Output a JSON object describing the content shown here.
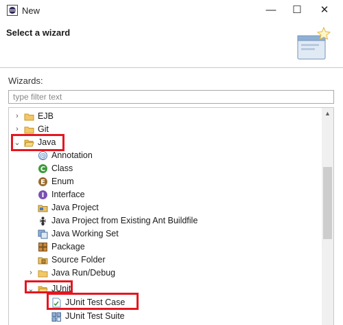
{
  "window": {
    "title": "New",
    "minimize_glyph": "—",
    "maximize_glyph": "☐",
    "close_glyph": "✕"
  },
  "banner": {
    "title": "Select a wizard",
    "icon": "wizard-banner-icon"
  },
  "wizards_label": "Wizards:",
  "filter": {
    "placeholder": "type filter text",
    "value": ""
  },
  "tree": {
    "items": [
      {
        "label": "EJB",
        "icon": "folder-icon",
        "state": "collapsed"
      },
      {
        "label": "Git",
        "icon": "folder-icon",
        "state": "collapsed"
      },
      {
        "label": "Java",
        "icon": "folder-open-icon",
        "state": "expanded",
        "highlighted": true
      },
      {
        "label": "Annotation",
        "icon": "annotation-icon"
      },
      {
        "label": "Class",
        "icon": "class-icon"
      },
      {
        "label": "Enum",
        "icon": "enum-icon"
      },
      {
        "label": "Interface",
        "icon": "interface-icon"
      },
      {
        "label": "Java Project",
        "icon": "java-project-icon"
      },
      {
        "label": "Java Project from Existing Ant Buildfile",
        "icon": "ant-icon"
      },
      {
        "label": "Java Working Set",
        "icon": "working-set-icon"
      },
      {
        "label": "Package",
        "icon": "package-icon"
      },
      {
        "label": "Source Folder",
        "icon": "source-folder-icon"
      },
      {
        "label": "Java Run/Debug",
        "icon": "folder-icon",
        "state": "collapsed"
      },
      {
        "label": "JUnit",
        "icon": "folder-open-icon",
        "state": "expanded",
        "highlighted": true
      },
      {
        "label": "JUnit Test Case",
        "icon": "junit-test-case-icon",
        "highlighted": true
      },
      {
        "label": "JUnit Test Suite",
        "icon": "junit-test-suite-icon"
      }
    ]
  },
  "colors": {
    "highlight_box": "#e4161f",
    "folder": "#e9b949",
    "class_green": "#3b9b3a",
    "interface_purple": "#7b4fb3",
    "enum_brown": "#9a6b2f"
  }
}
